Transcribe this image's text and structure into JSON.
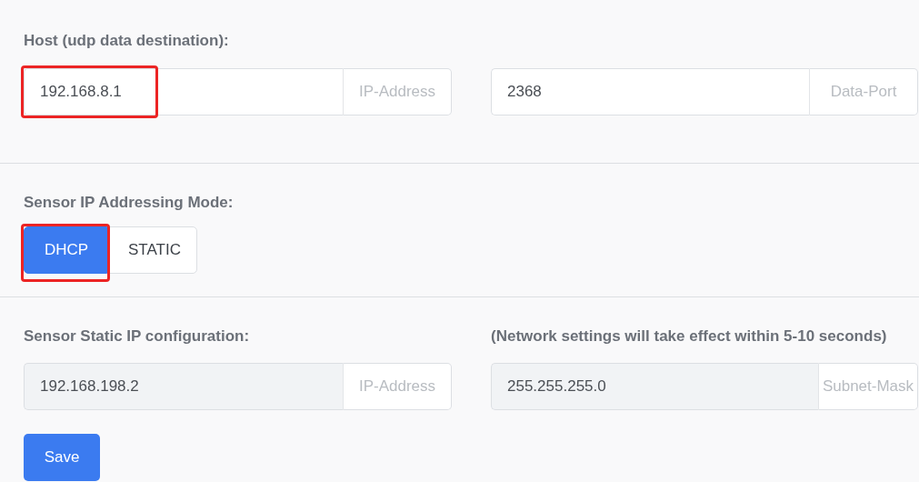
{
  "sections": [
    {
      "kind": "fields",
      "title": "Host (udp data destination):",
      "fields": [
        {
          "value": "192.168.8.1",
          "addon": "IP-Address",
          "disabled": false,
          "highlighted": true
        },
        {
          "value": "2368",
          "addon": "Data-Port",
          "disabled": false,
          "highlighted": false
        }
      ]
    },
    {
      "kind": "toggle",
      "title": "Sensor IP Addressing Mode:",
      "options": [
        {
          "label": "DHCP",
          "selected": true,
          "highlighted": true
        },
        {
          "label": "STATIC",
          "selected": false,
          "highlighted": false
        }
      ]
    },
    {
      "kind": "fields",
      "title": "Sensor Static IP configuration:",
      "note": "(Network settings will take effect within 5-10 seconds)",
      "fields": [
        {
          "value": "192.168.198.2",
          "addon": "IP-Address",
          "disabled": true,
          "highlighted": false
        },
        {
          "value": "255.255.255.0",
          "addon": "Subnet-Mask",
          "disabled": true,
          "highlighted": false
        }
      ],
      "save": "Save"
    }
  ]
}
